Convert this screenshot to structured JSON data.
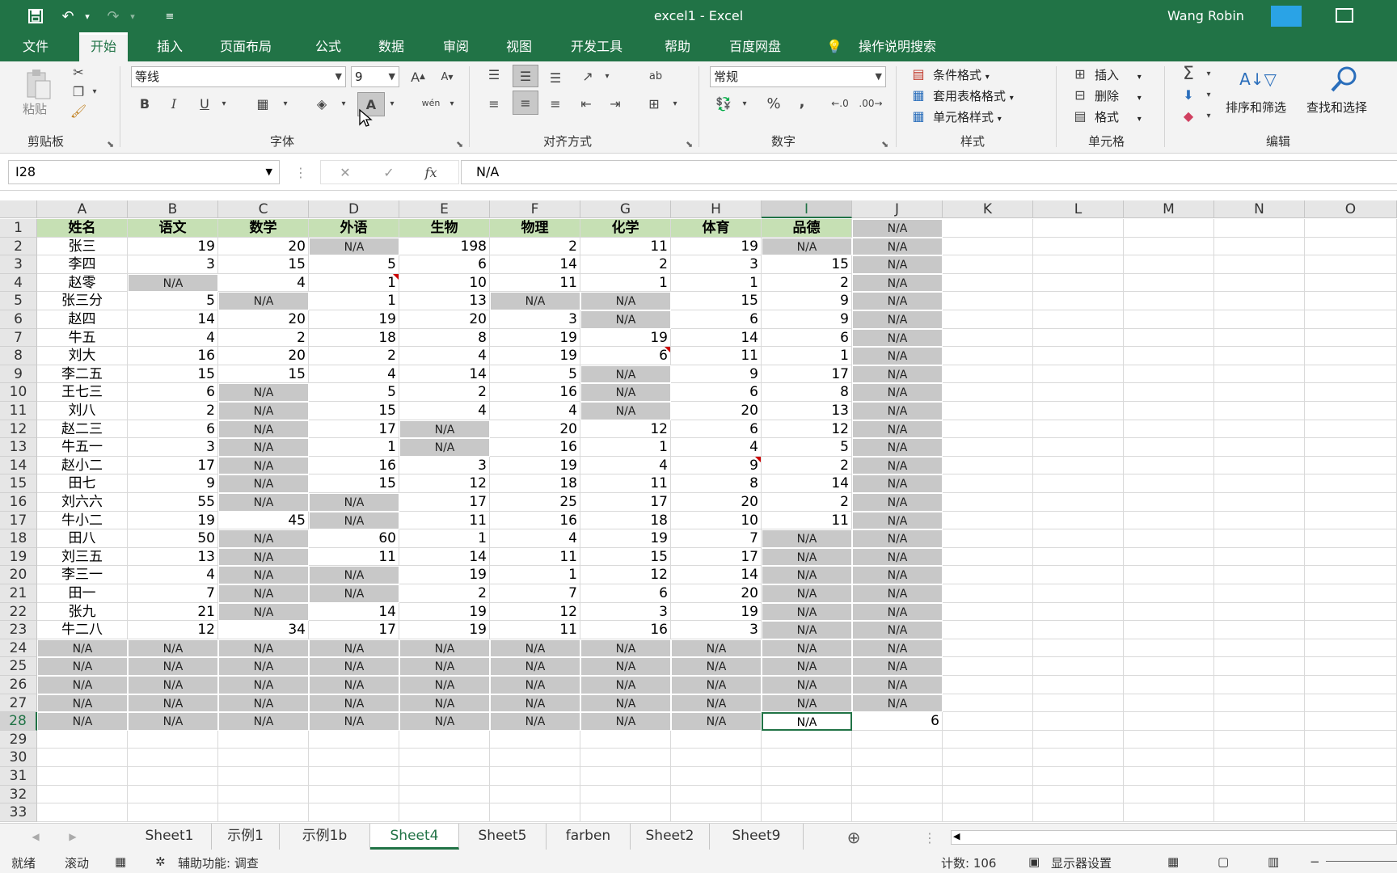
{
  "titlebar": {
    "title": "excel1  -  Excel",
    "user": "Wang Robin",
    "icons": [
      "save-icon",
      "undo-icon",
      "redo-icon",
      "customize-icon",
      "restore-icon"
    ]
  },
  "ribbon_tabs": [
    "文件",
    "开始",
    "插入",
    "页面布局",
    "公式",
    "数据",
    "审阅",
    "视图",
    "开发工具",
    "帮助",
    "百度网盘",
    "操作说明搜索"
  ],
  "ribbon_active": "开始",
  "ribbon": {
    "clipboard": {
      "paste": "粘贴",
      "label": "剪贴板"
    },
    "font": {
      "name": "等线",
      "size": "9",
      "bold": "B",
      "italic": "I",
      "underline": "U",
      "phonetic": "wén",
      "label": "字体"
    },
    "align": {
      "wrap": "ab",
      "label": "对齐方式"
    },
    "number": {
      "format": "常规",
      "percent": "%",
      "comma": ",",
      "label": "数字"
    },
    "styles": {
      "cond": "条件格式",
      "table": "套用表格格式",
      "cell": "单元格样式",
      "label": "样式"
    },
    "cells": {
      "insert": "插入",
      "delete": "删除",
      "format": "格式",
      "label": "单元格"
    },
    "editing": {
      "sort": "排序和筛选",
      "find": "查找和选择",
      "label": "编辑"
    }
  },
  "formula_bar": {
    "name_box": "I28",
    "fx": "fx",
    "content": "N/A"
  },
  "columns": [
    "A",
    "B",
    "C",
    "D",
    "E",
    "F",
    "G",
    "H",
    "I",
    "J",
    "K",
    "L",
    "M",
    "N",
    "O"
  ],
  "selected_col": "I",
  "selected_row": 28,
  "rows": [
    [
      "姓名",
      "语文",
      "数学",
      "外语",
      "生物",
      "物理",
      "化学",
      "体育",
      "品德",
      "N/A"
    ],
    [
      "张三",
      "19",
      "20",
      "N/A",
      "198",
      "2",
      "11",
      "19",
      "N/A",
      "N/A"
    ],
    [
      "李四",
      "3",
      "15",
      "5",
      "6",
      "14",
      "2",
      "3",
      "15",
      "N/A"
    ],
    [
      "赵零",
      "N/A",
      "4",
      "1",
      "10",
      "11",
      "1",
      "1",
      "2",
      "N/A"
    ],
    [
      "张三分",
      "5",
      "N/A",
      "1",
      "13",
      "N/A",
      "N/A",
      "15",
      "9",
      "N/A"
    ],
    [
      "赵四",
      "14",
      "20",
      "19",
      "20",
      "3",
      "N/A",
      "6",
      "9",
      "N/A"
    ],
    [
      "牛五",
      "4",
      "2",
      "18",
      "8",
      "19",
      "19",
      "14",
      "6",
      "N/A"
    ],
    [
      "刘大",
      "16",
      "20",
      "2",
      "4",
      "19",
      "6",
      "11",
      "1",
      "N/A"
    ],
    [
      "李二五",
      "15",
      "15",
      "4",
      "14",
      "5",
      "N/A",
      "9",
      "17",
      "N/A"
    ],
    [
      "王七三",
      "6",
      "N/A",
      "5",
      "2",
      "16",
      "N/A",
      "6",
      "8",
      "N/A"
    ],
    [
      "刘八",
      "2",
      "N/A",
      "15",
      "4",
      "4",
      "N/A",
      "20",
      "13",
      "N/A"
    ],
    [
      "赵二三",
      "6",
      "N/A",
      "17",
      "N/A",
      "20",
      "12",
      "6",
      "12",
      "N/A"
    ],
    [
      "牛五一",
      "3",
      "N/A",
      "1",
      "N/A",
      "16",
      "1",
      "4",
      "5",
      "N/A"
    ],
    [
      "赵小二",
      "17",
      "N/A",
      "16",
      "3",
      "19",
      "4",
      "9",
      "2",
      "N/A"
    ],
    [
      "田七",
      "9",
      "N/A",
      "15",
      "12",
      "18",
      "11",
      "8",
      "14",
      "N/A"
    ],
    [
      "刘六六",
      "55",
      "N/A",
      "N/A",
      "17",
      "25",
      "17",
      "20",
      "2",
      "N/A"
    ],
    [
      "牛小二",
      "19",
      "45",
      "N/A",
      "11",
      "16",
      "18",
      "10",
      "11",
      "N/A"
    ],
    [
      "田八",
      "50",
      "N/A",
      "60",
      "1",
      "4",
      "19",
      "7",
      "N/A",
      "N/A"
    ],
    [
      "刘三五",
      "13",
      "N/A",
      "11",
      "14",
      "11",
      "15",
      "17",
      "N/A",
      "N/A"
    ],
    [
      "李三一",
      "4",
      "N/A",
      "N/A",
      "19",
      "1",
      "12",
      "14",
      "N/A",
      "N/A"
    ],
    [
      "田一",
      "7",
      "N/A",
      "N/A",
      "2",
      "7",
      "6",
      "20",
      "N/A",
      "N/A"
    ],
    [
      "张九",
      "21",
      "N/A",
      "14",
      "19",
      "12",
      "3",
      "19",
      "N/A",
      "N/A"
    ],
    [
      "牛二八",
      "12",
      "34",
      "17",
      "19",
      "11",
      "16",
      "3",
      "N/A",
      "N/A"
    ],
    [
      "N/A",
      "N/A",
      "N/A",
      "N/A",
      "N/A",
      "N/A",
      "N/A",
      "N/A",
      "N/A",
      "N/A"
    ],
    [
      "N/A",
      "N/A",
      "N/A",
      "N/A",
      "N/A",
      "N/A",
      "N/A",
      "N/A",
      "N/A",
      "N/A"
    ],
    [
      "N/A",
      "N/A",
      "N/A",
      "N/A",
      "N/A",
      "N/A",
      "N/A",
      "N/A",
      "N/A",
      "N/A"
    ],
    [
      "N/A",
      "N/A",
      "N/A",
      "N/A",
      "N/A",
      "N/A",
      "N/A",
      "N/A",
      "N/A",
      "N/A"
    ],
    [
      "N/A",
      "N/A",
      "N/A",
      "N/A",
      "N/A",
      "N/A",
      "N/A",
      "N/A",
      "N/A",
      "6"
    ],
    [],
    [],
    [],
    [],
    []
  ],
  "sheet_tabs": [
    "Sheet1",
    "示例1",
    "示例1b",
    "Sheet4",
    "Sheet5",
    "farben",
    "Sheet2",
    "Sheet9"
  ],
  "active_sheet": "Sheet4",
  "status": {
    "ready": "就绪",
    "scroll": "滚动",
    "accessibility": "辅助功能: 调查",
    "count": "计数: 106",
    "display": "显示器设置"
  },
  "colors": {
    "excel_green": "#217346",
    "header_fill": "#c6e0b4",
    "na_fill": "#c8c8c8"
  }
}
